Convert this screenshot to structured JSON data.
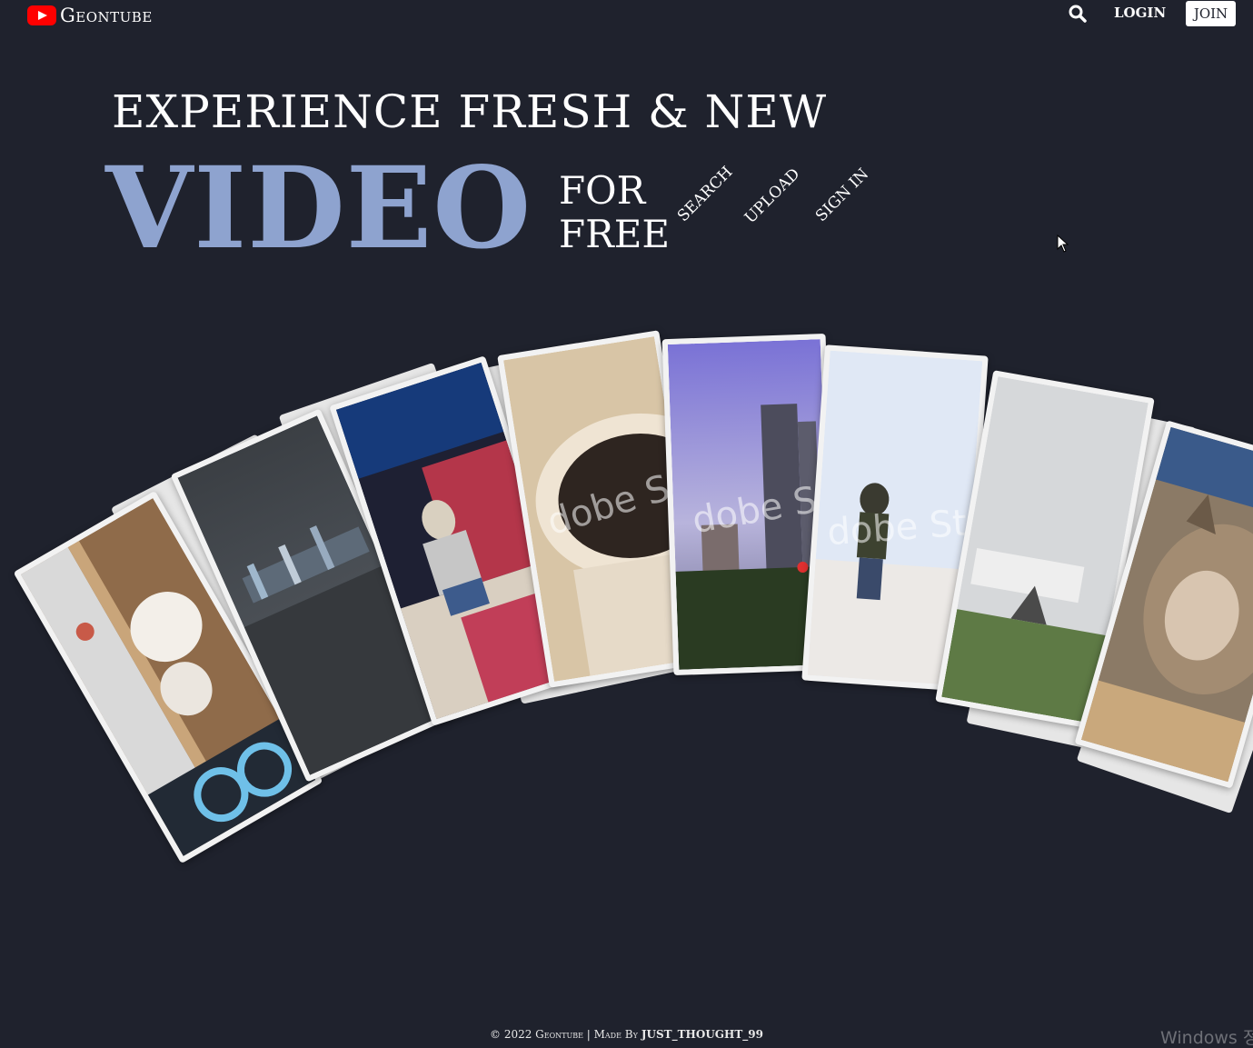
{
  "header": {
    "brand": "Geontube",
    "login_label": "LOGIN",
    "join_label": "JOIN",
    "icons": {
      "logo": "youtube-play-icon",
      "search": "search-icon"
    }
  },
  "hero": {
    "tagline": "EXPERIENCE FRESH & NEW",
    "headline": "VIDEO",
    "for_line": "FOR",
    "free_line": "FREE",
    "links": [
      "SEARCH",
      "UPLOAD",
      "SIGN IN"
    ]
  },
  "gallery": {
    "watermark": "dobe Sto",
    "cards": [
      {
        "name": "card-puppies"
      },
      {
        "name": "card-night-city"
      },
      {
        "name": "card-person-crate"
      },
      {
        "name": "card-coffee-cup"
      },
      {
        "name": "card-tower"
      },
      {
        "name": "card-beach-walk"
      },
      {
        "name": "card-foggy-village"
      },
      {
        "name": "card-cat"
      }
    ]
  },
  "footer": {
    "text": "© 2022 Geontube | Made By",
    "author": "JUST_THOUGHT_99"
  },
  "os_overlay": {
    "text": "Windows 정"
  },
  "colors": {
    "background": "#1f222d",
    "accent": "#8ea3cf",
    "brand_red": "#ff0000"
  }
}
